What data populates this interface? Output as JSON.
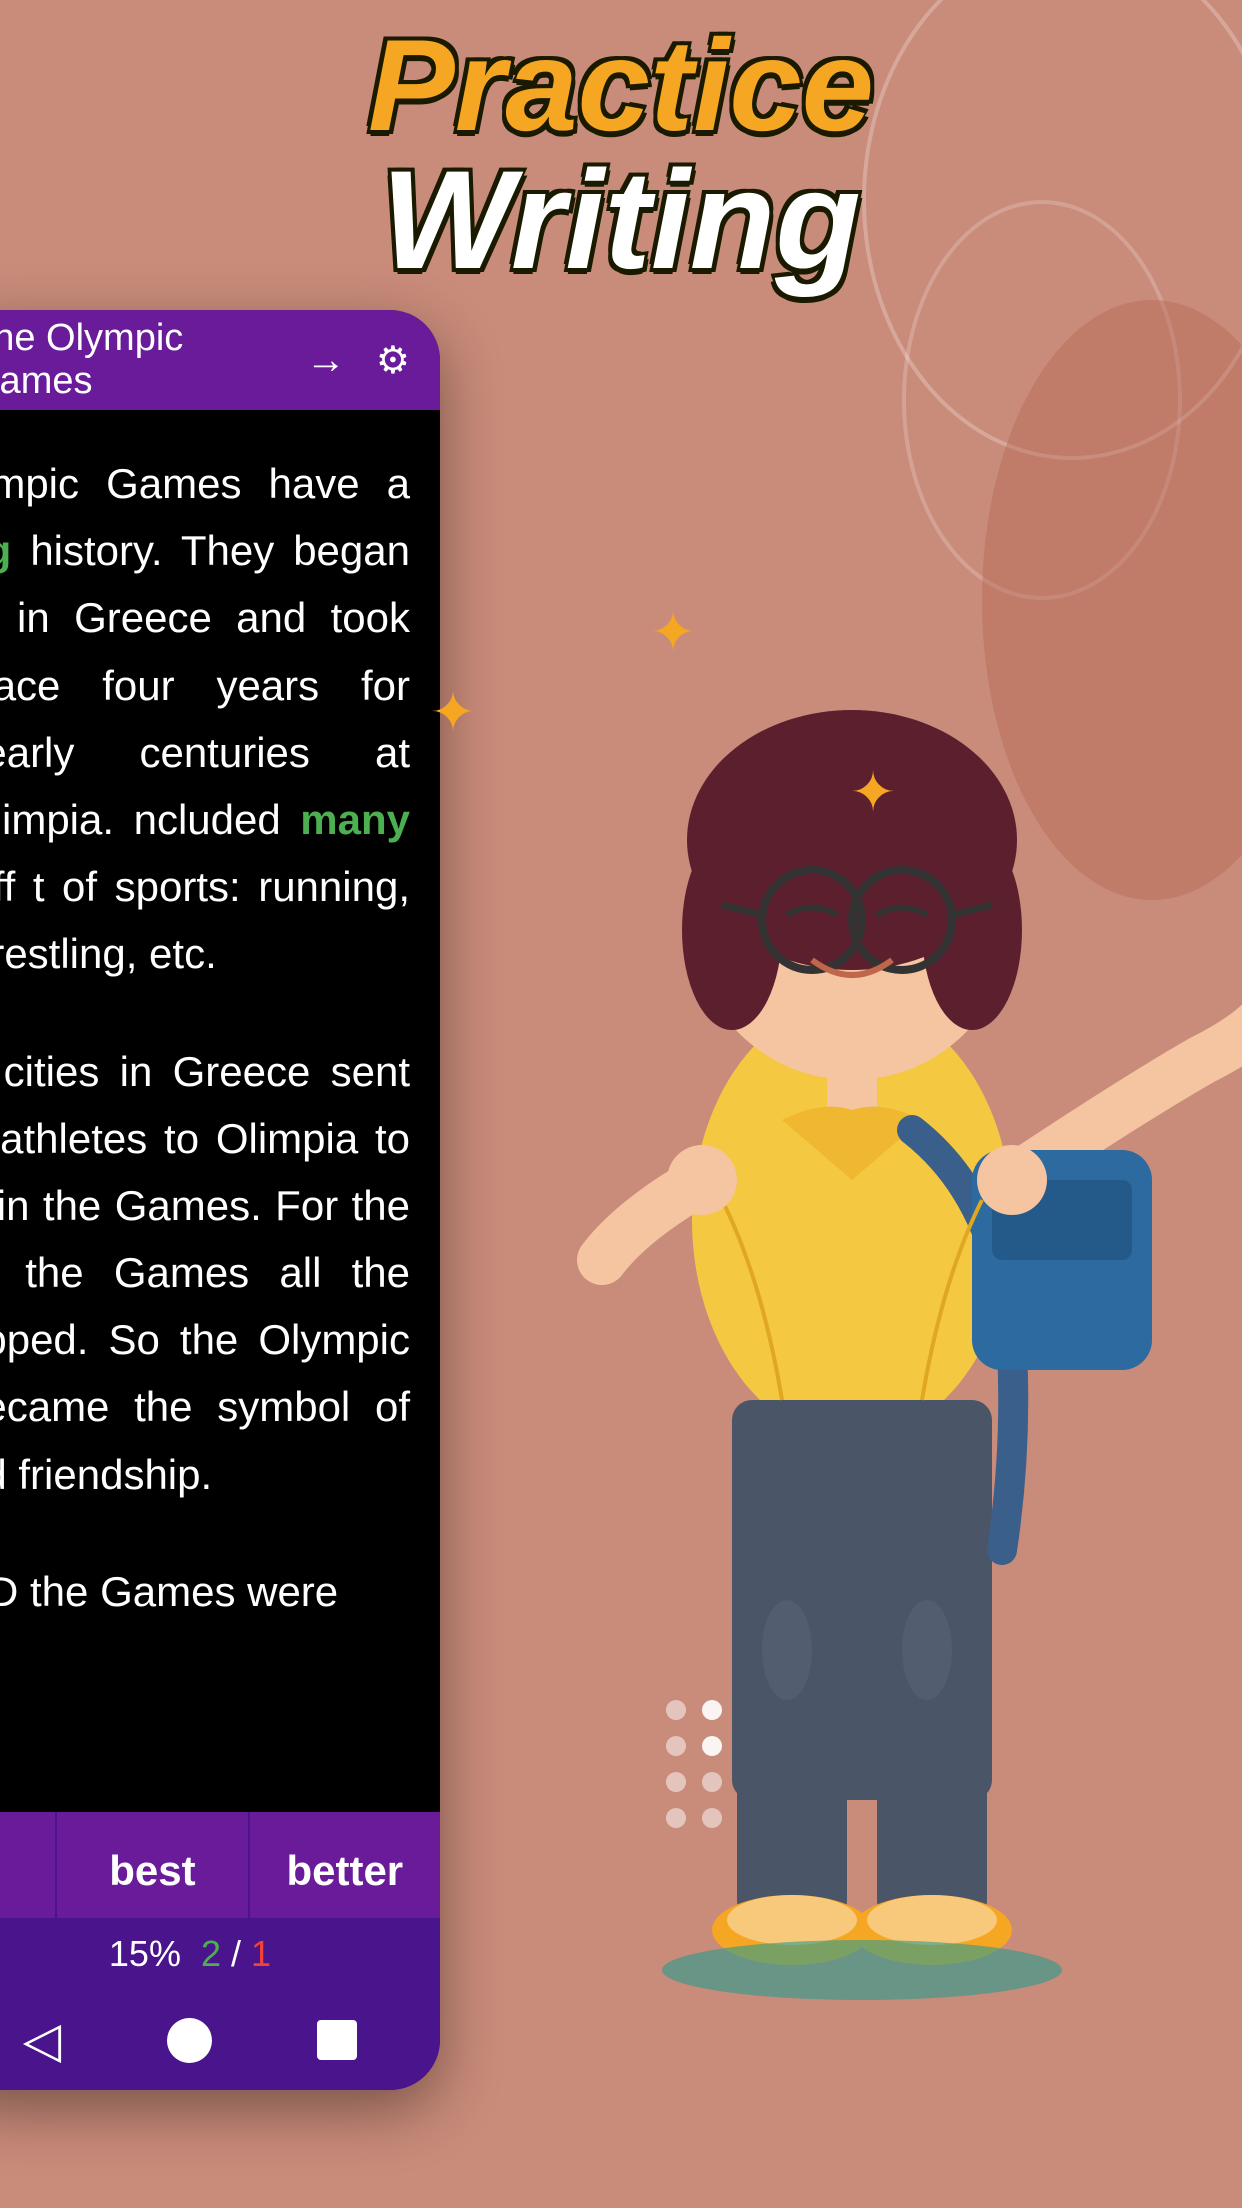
{
  "header": {
    "title_line1": "Practice",
    "title_line2": "Writing"
  },
  "app": {
    "lesson_title": "The Olympic Games",
    "arrow_icon": "→",
    "gear_icon": "⚙",
    "text_paragraphs": [
      "lympic Games have a ng history. They began in in Greece and took place four years for nearly centuries at Olimpia. ncluded many diff t of sports: running, wrestling, etc.",
      "e cities in Greece sent _ athletes to Olimpia to e in the Games. For the of the Games all the opped. So the Olympic became the symbol of nd friendship.",
      "AD the Games were"
    ],
    "answer_options": {
      "btn1_label": "best",
      "btn2_label": "better"
    },
    "progress": {
      "percent": "15%",
      "current": "2",
      "separator": "/",
      "total": "1"
    },
    "nav": {
      "back_icon": "◁",
      "home_icon": "●",
      "stop_icon": "■"
    }
  },
  "dots": [
    {
      "active": false
    },
    {
      "active": true
    },
    {
      "active": false
    },
    {
      "active": true
    },
    {
      "active": false
    },
    {
      "active": false
    },
    {
      "active": false
    },
    {
      "active": false
    }
  ],
  "colors": {
    "background": "#c98b7a",
    "phone_header": "#6a1b9a",
    "phone_screen": "#000000",
    "button_bg": "#6a1b9a",
    "nav_bar": "#4a148c",
    "highlight_green": "#4caf50",
    "title_orange": "#f5a623",
    "title_white": "#ffffff"
  }
}
